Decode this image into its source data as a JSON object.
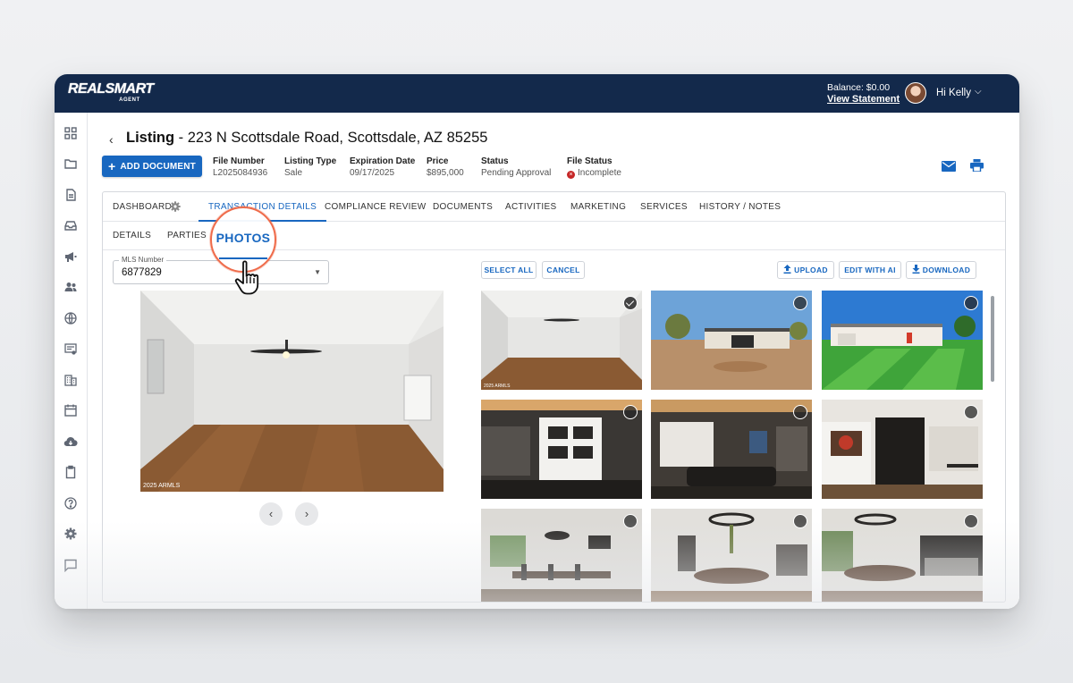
{
  "brand": {
    "logo_main": "REALSMART",
    "logo_sub": "AGENT"
  },
  "account": {
    "balance": "Balance: $0.00",
    "statement": "View Statement",
    "greeting": "Hi Kelly"
  },
  "listing": {
    "title_prefix": "Listing",
    "title_address": " - 223 N Scottsdale Road, Scottsdale, AZ 85255",
    "add_document": "ADD DOCUMENT",
    "meta": [
      {
        "label": "File Number",
        "value": "L2025084936"
      },
      {
        "label": "Listing Type",
        "value": "Sale"
      },
      {
        "label": "Expiration Date",
        "value": "09/17/2025"
      },
      {
        "label": "Price",
        "value": "$895,000"
      },
      {
        "label": "Status",
        "value": "Pending Approval"
      },
      {
        "label": "File Status",
        "value": "Incomplete"
      }
    ]
  },
  "tabs": [
    "DASHBOARD",
    "TRANSACTION DETAILS",
    "COMPLIANCE REVIEW",
    "DOCUMENTS",
    "ACTIVITIES",
    "MARKETING",
    "SERVICES",
    "HISTORY / NOTES"
  ],
  "active_tab": "TRANSACTION DETAILS",
  "subtabs": [
    "DETAILS",
    "PARTIES",
    "PHOTOS"
  ],
  "active_subtab": "PHOTOS",
  "mls": {
    "label": "MLS Number",
    "value": "6877829"
  },
  "photo_actions": {
    "select_all": "SELECT ALL",
    "cancel": "CANCEL",
    "upload": "UPLOAD",
    "edit_ai": "EDIT WITH AI",
    "download": "DOWNLOAD"
  },
  "watermark": "2025 ARMLS",
  "photos": [
    {
      "scene": "empty-room",
      "selected": true
    },
    {
      "scene": "exterior-desert",
      "selected": false
    },
    {
      "scene": "exterior-lawn",
      "selected": false
    },
    {
      "scene": "living-shelves",
      "selected": false
    },
    {
      "scene": "living-sofa",
      "selected": false
    },
    {
      "scene": "hall-art",
      "selected": false
    },
    {
      "scene": "dining-table",
      "selected": false
    },
    {
      "scene": "dining-chandelier",
      "selected": false
    },
    {
      "scene": "dining-kitchen",
      "selected": false
    }
  ],
  "icons": {
    "sidebar": [
      "dashboard-icon",
      "folder-icon",
      "document-icon",
      "inbox-icon",
      "megaphone-icon",
      "people-icon",
      "globe-icon",
      "cast-icon",
      "building-icon",
      "calendar-icon",
      "cloud-download-icon",
      "clipboard-icon",
      "help-icon",
      "settings-icon",
      "chat-icon"
    ]
  },
  "colors": {
    "navbar": "#13294b",
    "accent": "#1867c0",
    "callout": "#ef6b4a",
    "error": "#c62828"
  }
}
